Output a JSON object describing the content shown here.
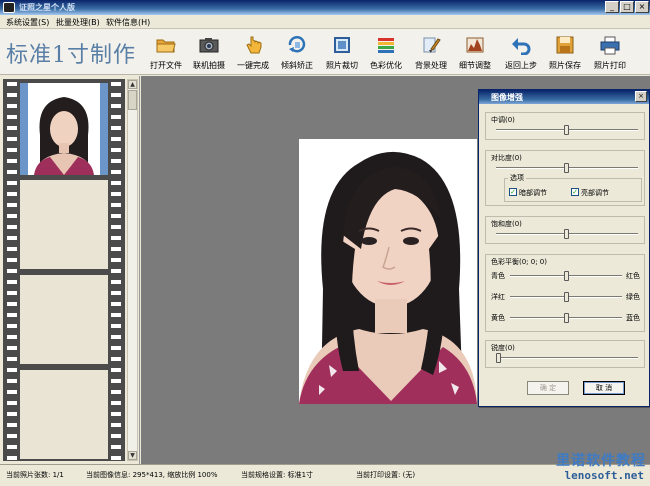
{
  "window": {
    "title": "证照之星个人版",
    "controls": [
      "minimize",
      "maximize",
      "close"
    ]
  },
  "menu": {
    "items": [
      "系统设置(S)",
      "批量处理(B)",
      "软件信息(H)"
    ]
  },
  "toolbar": {
    "app_heading": "标准1寸制作",
    "tools": [
      {
        "label": "打开文件",
        "icon": "folder-open-icon"
      },
      {
        "label": "联机拍摄",
        "icon": "camera-icon"
      },
      {
        "label": "一键完成",
        "icon": "hand-pointer-icon"
      },
      {
        "label": "倾斜矫正",
        "icon": "rotate-correct-icon"
      },
      {
        "label": "照片裁切",
        "icon": "crop-icon"
      },
      {
        "label": "色彩优化",
        "icon": "color-palette-icon"
      },
      {
        "label": "背景处理",
        "icon": "paint-brush-icon"
      },
      {
        "label": "细节调整",
        "icon": "detail-adjust-icon"
      },
      {
        "label": "返回上步",
        "icon": "undo-icon"
      },
      {
        "label": "照片保存",
        "icon": "save-icon"
      },
      {
        "label": "照片打印",
        "icon": "printer-icon"
      }
    ]
  },
  "film_strip": {
    "frames": 4,
    "selected_index": 0
  },
  "dialog": {
    "title": "图像增强",
    "midtone": {
      "label": "中调(0)",
      "value": 0.5
    },
    "contrast": {
      "label": "对比度(0)",
      "value": 0.5
    },
    "options": {
      "label": "选项",
      "dark_adjust": {
        "label": "暗部调节",
        "checked": true
      },
      "bright_adjust": {
        "label": "亮部调节",
        "checked": true
      }
    },
    "saturation": {
      "label": "饱和度(0)",
      "value": 0.5
    },
    "color_balance": {
      "label": "色彩平衡(0; 0; 0)",
      "rows": [
        {
          "left": "青色",
          "right": "红色",
          "value": 0.5
        },
        {
          "left": "洋红",
          "right": "绿色",
          "value": 0.5
        },
        {
          "left": "黄色",
          "right": "蓝色",
          "value": 0.5
        }
      ]
    },
    "sharpness": {
      "label": "锐度(0)",
      "value": 0.0
    },
    "ok_label": "确 定",
    "cancel_label": "取 消"
  },
  "status": {
    "photo_count": "当前照片张数: 1/1",
    "image_info": "当前图像信息: 295*413, 缩放比例 100%",
    "spec": "当前规格设置: 标准1寸",
    "print": "当前打印设置: (无)"
  },
  "watermark": {
    "line1": "里诺软件教程",
    "line2": "lenosoft.net"
  },
  "colors": {
    "title_bar": "#0A246A",
    "heading_blue": "#5A7FA6",
    "canvas_gray": "#7B7B7B",
    "selected_frame": "#6C96C9"
  }
}
